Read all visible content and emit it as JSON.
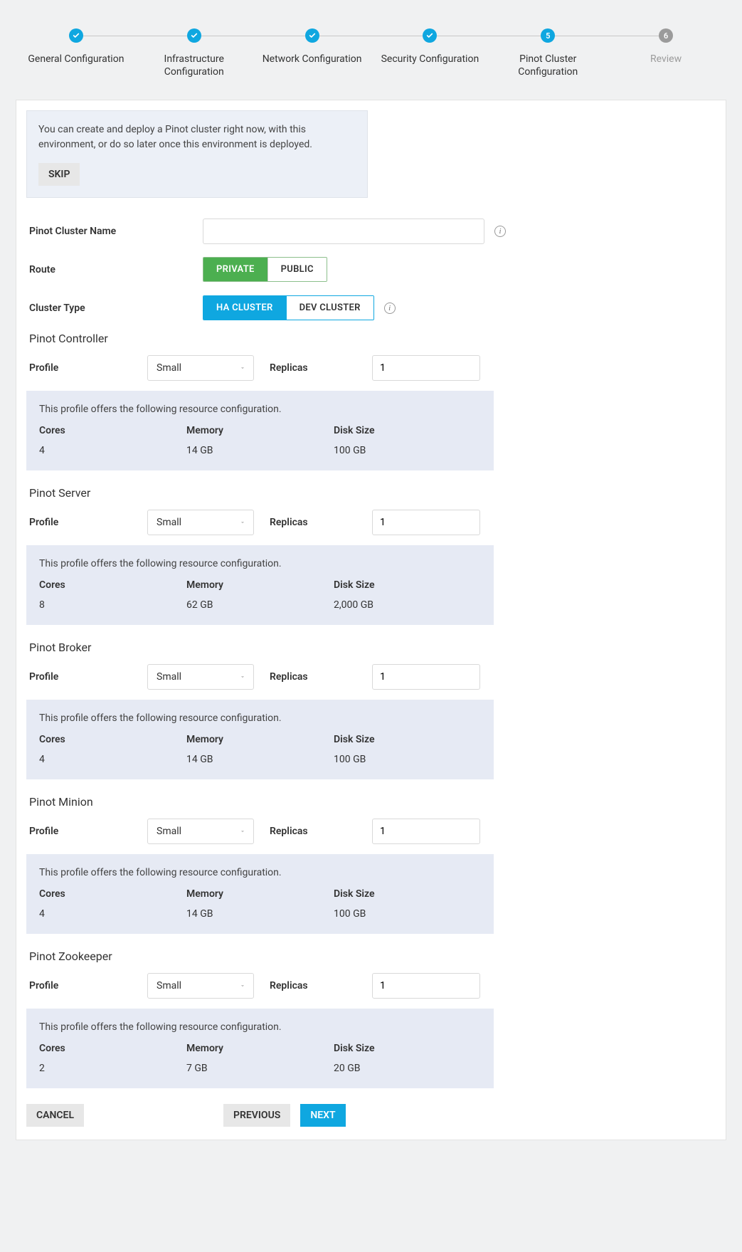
{
  "stepper": {
    "steps": [
      {
        "label": "General Configuration",
        "state": "done"
      },
      {
        "label": "Infrastructure Configuration",
        "state": "done"
      },
      {
        "label": "Network Configuration",
        "state": "done"
      },
      {
        "label": "Security Configuration",
        "state": "done"
      },
      {
        "label": "Pinot Cluster Configuration",
        "state": "current",
        "number": "5"
      },
      {
        "label": "Review",
        "state": "pending",
        "number": "6"
      }
    ]
  },
  "skip_box": {
    "text": "You can create and deploy a Pinot cluster right now, with this environment, or do so later once this environment is deployed.",
    "skip_label": "SKIP"
  },
  "fields": {
    "cluster_name": {
      "label": "Pinot Cluster Name",
      "value": ""
    },
    "route": {
      "label": "Route",
      "options": [
        "PRIVATE",
        "PUBLIC"
      ],
      "selected": "PRIVATE"
    },
    "cluster_type": {
      "label": "Cluster Type",
      "options": [
        "HA CLUSTER",
        "DEV CLUSTER"
      ],
      "selected": "HA CLUSTER"
    }
  },
  "sections": [
    {
      "title": "Pinot Controller",
      "profile_label": "Profile",
      "profile_value": "Small",
      "replicas_label": "Replicas",
      "replicas_value": "1",
      "box_desc": "This profile offers the following resource configuration.",
      "cores_label": "Cores",
      "cores_value": "4",
      "memory_label": "Memory",
      "memory_value": "14 GB",
      "disk_label": "Disk Size",
      "disk_value": "100 GB"
    },
    {
      "title": "Pinot Server",
      "profile_label": "Profile",
      "profile_value": "Small",
      "replicas_label": "Replicas",
      "replicas_value": "1",
      "box_desc": "This profile offers the following resource configuration.",
      "cores_label": "Cores",
      "cores_value": "8",
      "memory_label": "Memory",
      "memory_value": "62 GB",
      "disk_label": "Disk Size",
      "disk_value": "2,000 GB"
    },
    {
      "title": "Pinot Broker",
      "profile_label": "Profile",
      "profile_value": "Small",
      "replicas_label": "Replicas",
      "replicas_value": "1",
      "box_desc": "This profile offers the following resource configuration.",
      "cores_label": "Cores",
      "cores_value": "4",
      "memory_label": "Memory",
      "memory_value": "14 GB",
      "disk_label": "Disk Size",
      "disk_value": "100 GB"
    },
    {
      "title": "Pinot Minion",
      "profile_label": "Profile",
      "profile_value": "Small",
      "replicas_label": "Replicas",
      "replicas_value": "1",
      "box_desc": "This profile offers the following resource configuration.",
      "cores_label": "Cores",
      "cores_value": "4",
      "memory_label": "Memory",
      "memory_value": "14 GB",
      "disk_label": "Disk Size",
      "disk_value": "100 GB"
    },
    {
      "title": "Pinot Zookeeper",
      "profile_label": "Profile",
      "profile_value": "Small",
      "replicas_label": "Replicas",
      "replicas_value": "1",
      "box_desc": "This profile offers the following resource configuration.",
      "cores_label": "Cores",
      "cores_value": "2",
      "memory_label": "Memory",
      "memory_value": "7 GB",
      "disk_label": "Disk Size",
      "disk_value": "20 GB"
    }
  ],
  "footer": {
    "cancel": "CANCEL",
    "previous": "PREVIOUS",
    "next": "NEXT"
  }
}
